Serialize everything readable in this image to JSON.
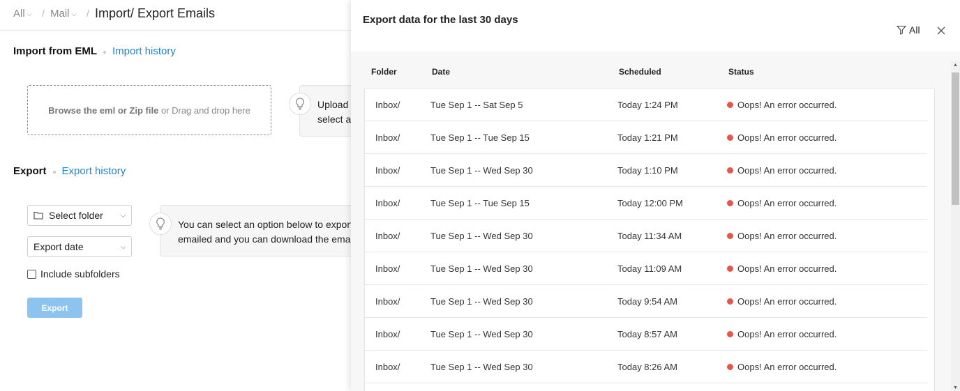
{
  "breadcrumb": {
    "items": [
      {
        "label": "All"
      },
      {
        "label": "Mail"
      }
    ],
    "separator": "/",
    "title": "Import/ Export Emails"
  },
  "import": {
    "heading": "Import from EML",
    "history_link": "Import history",
    "drop_bold": "Browse the eml or Zip file",
    "drop_rest": " or Drag and drop here",
    "tip_line1": "Upload",
    "tip_line2": "select a"
  },
  "export": {
    "heading": "Export",
    "history_link": "Export history",
    "folder_select": "Select folder",
    "date_select": "Export date",
    "include_subfolders": "Include subfolders",
    "button": "Export",
    "tip_line1": "You can select an option below to export",
    "tip_line2": "emailed and you can download the emails"
  },
  "panel": {
    "title": "Export data for the last 30 days",
    "filter_label": "All",
    "columns": [
      "Folder",
      "Date",
      "Scheduled",
      "Status"
    ],
    "rows": [
      {
        "folder": "Inbox/",
        "date": "Tue Sep 1 -- Sat Sep 5",
        "scheduled": "Today 1:24 PM",
        "status": "Oops! An error occurred."
      },
      {
        "folder": "Inbox/",
        "date": "Tue Sep 1 -- Tue Sep 15",
        "scheduled": "Today 1:21 PM",
        "status": "Oops! An error occurred."
      },
      {
        "folder": "Inbox/",
        "date": "Tue Sep 1 -- Wed Sep 30",
        "scheduled": "Today 1:10 PM",
        "status": "Oops! An error occurred."
      },
      {
        "folder": "Inbox/",
        "date": "Tue Sep 1 -- Tue Sep 15",
        "scheduled": "Today 12:00 PM",
        "status": "Oops! An error occurred."
      },
      {
        "folder": "Inbox/",
        "date": "Tue Sep 1 -- Wed Sep 30",
        "scheduled": "Today 11:34 AM",
        "status": "Oops! An error occurred."
      },
      {
        "folder": "Inbox/",
        "date": "Tue Sep 1 -- Wed Sep 30",
        "scheduled": "Today 11:09 AM",
        "status": "Oops! An error occurred."
      },
      {
        "folder": "Inbox/",
        "date": "Tue Sep 1 -- Wed Sep 30",
        "scheduled": "Today 9:54 AM",
        "status": "Oops! An error occurred."
      },
      {
        "folder": "Inbox/",
        "date": "Tue Sep 1 -- Wed Sep 30",
        "scheduled": "Today 8:57 AM",
        "status": "Oops! An error occurred."
      },
      {
        "folder": "Inbox/",
        "date": "Tue Sep 1 -- Wed Sep 30",
        "scheduled": "Today 8:26 AM",
        "status": "Oops! An error occurred."
      }
    ]
  },
  "icons": {
    "dropdown": "chevron-down-icon",
    "tip": "lightbulb-icon",
    "folder": "folder-icon",
    "filter": "filter-icon",
    "close": "close-icon",
    "status": "error-dot"
  },
  "colors": {
    "accent": "#1e86d6",
    "button_disabled": "#8cc4ef",
    "error": "#e5564d",
    "panel_bg": "#f7f7f7"
  }
}
